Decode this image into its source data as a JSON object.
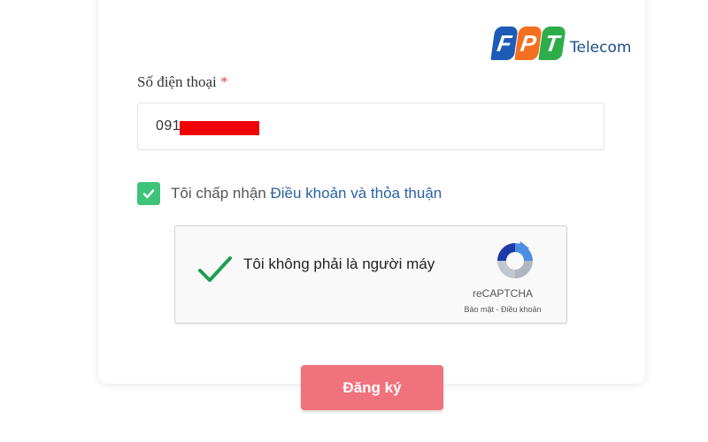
{
  "brand": {
    "logo_letters": [
      "F",
      "P",
      "T"
    ],
    "logo_colors": [
      "#1e5bb8",
      "#f37021",
      "#2eae4a"
    ],
    "logo_text": "Telecom",
    "icon": "fpt-logo"
  },
  "form": {
    "phone_label": "Số điện thoại",
    "required_mark": "*",
    "phone_value": "091",
    "phone_redacted": true
  },
  "terms": {
    "checked": true,
    "prefix": "Tôi chấp nhận",
    "link_text": "Điều khoản và thỏa thuận"
  },
  "recaptcha": {
    "status": "checked",
    "label": "Tôi không phải là người máy",
    "brand": "reCAPTCHA",
    "links": "Bảo mật - Điều khoản",
    "icons": [
      "checkmark-icon",
      "recaptcha-logo-icon"
    ]
  },
  "actions": {
    "submit_label": "Đăng ký"
  },
  "colors": {
    "checkbox": "#3ec47a",
    "link": "#2b61a3",
    "submit": "#f0727c",
    "redaction": "#f00000"
  }
}
